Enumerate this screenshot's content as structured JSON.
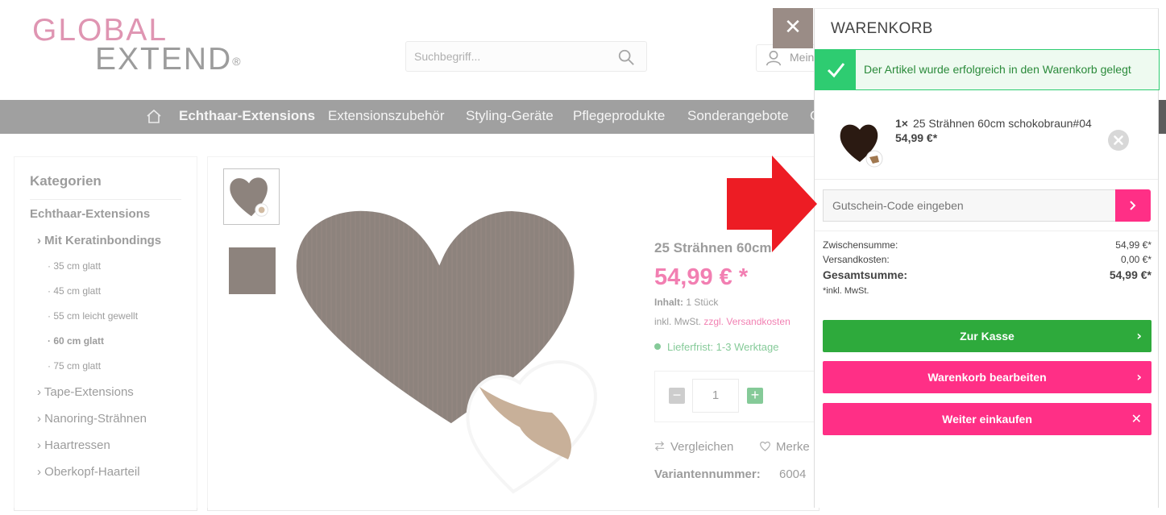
{
  "header": {
    "logo_line1": "GLOBAL",
    "logo_line2": "EXTEND",
    "logo_reg": "®",
    "search_placeholder": "Suchbegriff...",
    "account_label": "Mein"
  },
  "nav": {
    "items": [
      "Echthaar-Extensions",
      "Extensionszubehör",
      "Styling-Geräte",
      "Pflegeprodukte",
      "Sonderangebote",
      "G"
    ]
  },
  "sidebar": {
    "title": "Kategorien",
    "items": [
      {
        "label": "Echthaar-Extensions"
      },
      {
        "label": "› Mit Keratinbondings"
      },
      {
        "label": "· 35 cm glatt"
      },
      {
        "label": "· 45 cm glatt"
      },
      {
        "label": "· 55 cm leicht gewellt"
      },
      {
        "label": "· 60 cm glatt"
      },
      {
        "label": "· 75 cm glatt"
      },
      {
        "label": "› Tape-Extensions"
      },
      {
        "label": "› Nanoring-Strähnen"
      },
      {
        "label": "› Haartressen"
      },
      {
        "label": "› Oberkopf-Haarteil"
      }
    ]
  },
  "product": {
    "name": "25 Strähnen 60cm",
    "price": "54,99 € *",
    "content_label": "Inhalt:",
    "content_value": " 1 Stück",
    "tax_text": "inkl. MwSt. ",
    "shipping_link": "zzgl. Versandkosten",
    "delivery": "Lieferfrist: 1-3 Werktage",
    "quantity": "1",
    "compare_label": "Vergleichen",
    "wishlist_label": "Merke",
    "variant_label": "Variantennummer:",
    "variant_value": "6004"
  },
  "cart": {
    "close_symbol": "✕",
    "title": "WARENKORB",
    "success_message": "Der Artikel wurde erfolgreich in den Warenkorb gelegt",
    "item": {
      "qty": "1×",
      "name": "25 Strähnen 60cm schokobraun#04",
      "price": "54,99 €*"
    },
    "voucher_placeholder": "Gutschein-Code eingeben",
    "subtotal_label": "Zwischensumme:",
    "subtotal_value": "54,99 €*",
    "shipping_label": "Versandkosten:",
    "shipping_value": "0,00 €*",
    "total_label": "Gesamtsumme:",
    "total_value": "54,99 €*",
    "tax_note": "*inkl. MwSt.",
    "checkout_button": "Zur Kasse",
    "edit_button": "Warenkorb bearbeiten",
    "continue_button": "Weiter einkaufen",
    "arrow_right": "›",
    "close_x": "✕"
  },
  "colors": {
    "accent_pink": "#ff2f86",
    "checkout_green": "#2eaa3c",
    "success_green": "#2ecc71",
    "annotation_red": "#ed1c24"
  }
}
